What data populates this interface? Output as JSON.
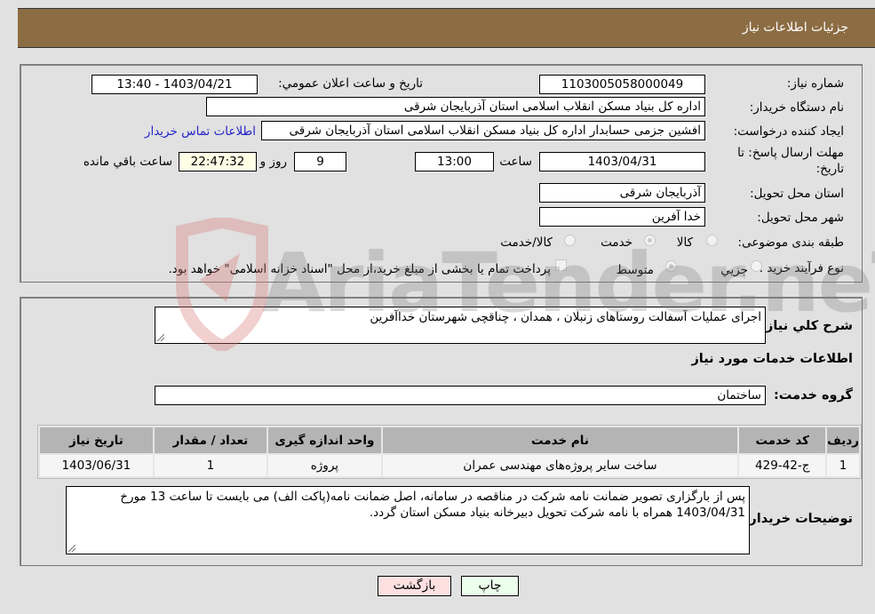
{
  "header": {
    "title": "جزئیات اطلاعات نیاز"
  },
  "form": {
    "need_number": {
      "label": "شماره نیاز:",
      "value": "1103005058000049"
    },
    "announce_datetime": {
      "label": "تاریخ و ساعت اعلان عمومي:",
      "value": "1403/04/21 - 13:40"
    },
    "buyer_org": {
      "label": "نام دستگاه خریدار:",
      "value": "اداره کل بنیاد مسکن انقلاب اسلامی استان آذربایجان شرقی"
    },
    "requester": {
      "label": "ایجاد کننده درخواست:",
      "value": "افشین جزمی حسابدار اداره کل بنیاد مسکن انقلاب اسلامی استان آذربایجان شرقی",
      "contact_link": "اطلاعات تماس خریدار"
    },
    "deadline": {
      "label_line1": "مهلت ارسال پاسخ: تا",
      "label_line2": "تاریخ:",
      "date": "1403/04/31",
      "time_label": "ساعت",
      "time": "13:00",
      "days": "9",
      "days_label": "روز و",
      "remaining": "22:47:32",
      "remaining_label": "ساعت باقي مانده"
    },
    "delivery_province": {
      "label": "استان محل تحویل:",
      "value": "آذربایجان شرقی"
    },
    "delivery_city": {
      "label": "شهر محل تحویل:",
      "value": "خدا آفرین"
    },
    "category": {
      "label": "طبقه بندی موضوعی:",
      "options": [
        "کالا",
        "خدمت",
        "کالا/خدمت"
      ],
      "selected": "خدمت"
    },
    "process_type": {
      "label": "نوع فرآیند خرید :",
      "options": [
        "جزیي",
        "متوسط"
      ],
      "selected": "متوسط",
      "treasury_note": "پرداخت تمام یا بخشی از مبلغ خرید،از محل \"اسناد خزانه اسلامی\" خواهد بود."
    }
  },
  "details": {
    "summary_label": "شرح کلي نياز:",
    "summary_value": "اجرای عملیات آسفالت  روستاهای  زنبلان ، همدان ، چناقچی شهرستان خداآفرین",
    "services_heading": "اطلاعات خدمات مورد نیاز",
    "service_group_label": "گروه خدمت:",
    "service_group_value": "ساختمان",
    "table": {
      "headers": [
        "ردیف",
        "کد خدمت",
        "نام خدمت",
        "واحد اندازه گیری",
        "تعداد / مقدار",
        "تاریخ نیاز"
      ],
      "rows": [
        [
          "1",
          "ج-42-429",
          "ساخت سایر پروژه‌های مهندسی عمران",
          "پروژه",
          "1",
          "1403/06/31"
        ]
      ]
    },
    "buyer_notes_label": "توضیحات خریدار:",
    "buyer_notes_value": "پس از بارگزاری تصویر ضمانت نامه شرکت در مناقصه در سامانه، اصل ضمانت نامه(پاکت الف) می بایست تا ساعت 13 مورخ 1403/04/31 همراه با نامه شرکت تحویل دبیرخانه بنیاد مسکن استان گردد."
  },
  "buttons": {
    "print": "چاپ",
    "back": "بازگشت"
  },
  "watermark": {
    "text": "AriaTender.neT",
    "accent": "#d9a0a0"
  }
}
